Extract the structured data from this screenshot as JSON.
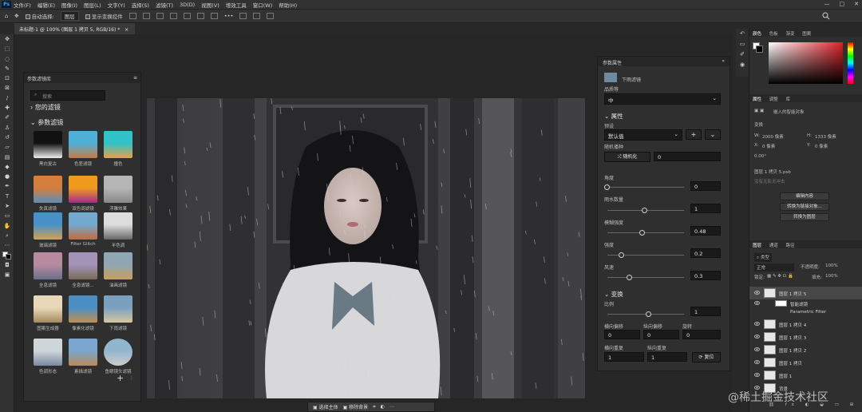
{
  "menu": {
    "app_logo": "Ps",
    "items": [
      "文件(F)",
      "编辑(E)",
      "图像(I)",
      "图层(L)",
      "文字(Y)",
      "选择(S)",
      "滤镜(T)",
      "3D(D)",
      "视图(V)",
      "增效工具",
      "窗口(W)",
      "帮助(H)"
    ]
  },
  "options": {
    "auto_select_label": "自动选择:",
    "auto_select_value": "图层",
    "show_transform_label": "显示变换控件",
    "more": "•••"
  },
  "document": {
    "tab_title": "未标题-1 @ 100% (图层 1 拷贝 5, RGB/16) *"
  },
  "filter_library": {
    "title": "参数滤镜库",
    "search_placeholder": "搜索",
    "my_filters": "您的滤镜",
    "param_filters": "参数滤镜",
    "items": [
      {
        "label": "黑白复古"
      },
      {
        "label": "色差滤镜"
      },
      {
        "label": "撞色"
      },
      {
        "label": "失真滤镜"
      },
      {
        "label": "双色调滤镜"
      },
      {
        "label": "浮雕效果"
      },
      {
        "label": "玻璃滤镜"
      },
      {
        "label": "Filter Glitch"
      },
      {
        "label": "半色调"
      },
      {
        "label": "全息滤镜"
      },
      {
        "label": "全息滤镜..."
      },
      {
        "label": "油画滤镜"
      },
      {
        "label": "图案生成器"
      },
      {
        "label": "像素化滤镜"
      },
      {
        "label": "下雨滤镜"
      },
      {
        "label": "色调形态"
      },
      {
        "label": "素描滤镜"
      },
      {
        "label": "鱼眼镜头滤镜"
      }
    ],
    "add": "+"
  },
  "params": {
    "panel_title": "参数属性",
    "filter_name": "下雨滤镜",
    "quality_label": "品质等",
    "quality_value": "中",
    "section_props": "属性",
    "preset_label": "预设",
    "preset_value": "默认值",
    "random_seed_label": "随机播种",
    "random_btn": "随机化",
    "random_value": "0",
    "angle_label": "角度",
    "angle_value": "0",
    "raindrop_label": "雨水数量",
    "raindrop_value": "1",
    "blur_label": "模糊强度",
    "blur_value": "0.48",
    "length_label": "强度",
    "length_value": "0.2",
    "speed_label": "风速",
    "speed_value": "0.3",
    "section_transform": "变换",
    "scale_label": "比例",
    "scale_value": "1",
    "hshear_label": "横向偏移",
    "vshear_label": "纵向偏移",
    "rotate_label": "旋转",
    "hshear_value": "0",
    "vshear_value": "0",
    "rotate_value": "0",
    "hscale_label": "横向重复",
    "vscale_label": "纵向重复",
    "hscale_value": "1",
    "vscale_value": "1",
    "reset": "复位"
  },
  "color_panel": {
    "tabs": [
      "颜色",
      "色板",
      "渐变",
      "图案"
    ],
    "accent": "#e0202a"
  },
  "properties_panel": {
    "tabs": [
      "属性",
      "调整",
      "库"
    ],
    "smart_obj_label": "嵌入的智能对象",
    "transform_label": "变换",
    "w_label": "W:",
    "w_value": "2000 像素",
    "h_label": "H:",
    "h_value": "1333 像素",
    "x_label": "X:",
    "x_value": "0 像素",
    "y_label": "Y:",
    "y_value": "0 像素",
    "angle_value": "0.00°",
    "file_name": "图层 1 拷贝 5.psb",
    "linked_label": "没有无影无冲击",
    "btn_edit": "编辑内容",
    "btn_convert": "转换为链接对象...",
    "btn_layers": "转换为图层"
  },
  "layers_panel": {
    "tabs": [
      "图层",
      "通道",
      "路径"
    ],
    "kind_label": "类型",
    "blend_mode": "正常",
    "opacity_label": "不透明度:",
    "opacity_value": "100%",
    "lock_label": "锁定:",
    "fill_label": "填充:",
    "fill_value": "100%",
    "layers": [
      {
        "name": "图层 1 拷贝 5"
      },
      {
        "name": "智能滤镜"
      },
      {
        "name": "Parametric Filter"
      },
      {
        "name": "图层 1 拷贝 4"
      },
      {
        "name": "图层 1 拷贝 3"
      },
      {
        "name": "图层 1 拷贝 2"
      },
      {
        "name": "图层 1 拷贝"
      },
      {
        "name": "图层 1"
      },
      {
        "name": "背景"
      }
    ]
  },
  "floatbar": {
    "select_subject": "选择主体",
    "remove_bg": "移除背景"
  },
  "watermark": "@稀土掘金技术社区"
}
